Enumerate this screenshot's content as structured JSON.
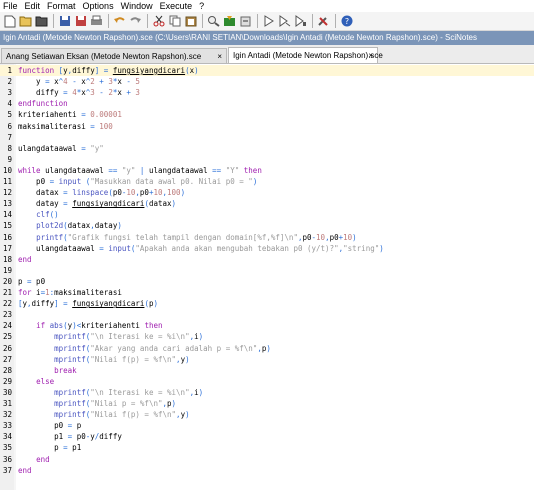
{
  "menubar": [
    "File",
    "Edit",
    "Format",
    "Options",
    "Window",
    "Execute",
    "?"
  ],
  "toolbar_icons": [
    "new-file-icon",
    "open-folder-icon",
    "open-file-icon",
    "sep",
    "save-icon",
    "save-as-icon",
    "print-icon",
    "sep",
    "undo-icon",
    "redo-icon",
    "sep",
    "cut-icon",
    "copy-icon",
    "paste-icon",
    "sep",
    "find-icon",
    "execute-file-icon",
    "load-into-scilab-icon",
    "sep",
    "execute-icon",
    "execute-until-cursor-icon",
    "execute-selection-icon",
    "sep",
    "tools-icon",
    "sep",
    "help-icon"
  ],
  "window_title": "Igin Antadi (Metode Newton Rapshon).sce (C:\\Users\\RANI SETIAN\\Downloads\\Igin Antadi (Metode Newton Rapshon).sce) - SciNotes",
  "tabs": [
    {
      "label": "Anang Setiawan Eksan (Metode Newton Rapshon).sce",
      "close": "×"
    },
    {
      "label": "Igin Antadi (Metode Newton Rapshon).sce",
      "close": "×"
    }
  ],
  "colors": {
    "keyword": "#a020b0",
    "function": "#4a55c0",
    "string": "#9a9a9a",
    "number": "#bc7a7a",
    "titlebar": "#7b95b8"
  },
  "code_lines": [
    {
      "n": "1",
      "t": "function [y,diffy] = fungsiyangdicari(x)"
    },
    {
      "n": "2",
      "t": "    y = x^4 - x^2 + 3*x - 5"
    },
    {
      "n": "3",
      "t": "    diffy = 4*x^3 - 2*x + 3"
    },
    {
      "n": "4",
      "t": "endfunction"
    },
    {
      "n": "5",
      "t": "kriteriahenti = 0.00001"
    },
    {
      "n": "6",
      "t": "maksimaliterasi = 100"
    },
    {
      "n": "7",
      "t": ""
    },
    {
      "n": "8",
      "t": "ulangdataawal = \"y\""
    },
    {
      "n": "9",
      "t": ""
    },
    {
      "n": "10",
      "t": "while ulangdataawal == \"y\" | ulangdataawal == \"Y\" then"
    },
    {
      "n": "11",
      "t": "    p0 = input (\"Masukkan data awal p0. Nilai p0 = \")"
    },
    {
      "n": "12",
      "t": "    datax = linspace(p0-10,p0+10,100)"
    },
    {
      "n": "13",
      "t": "    datay = fungsiyangdicari(datax)"
    },
    {
      "n": "14",
      "t": "    clf()"
    },
    {
      "n": "15",
      "t": "    plot2d(datax,datay)"
    },
    {
      "n": "16",
      "t": "    printf(\"Grafik fungsi telah tampil dengan domain[%f,%f]\\n\",p0-10,p0+10)"
    },
    {
      "n": "17",
      "t": "    ulangdataawal = input(\"Apakah anda akan mengubah tebakan p0 (y/t)?\",\"string\")"
    },
    {
      "n": "18",
      "t": "end"
    },
    {
      "n": "19",
      "t": ""
    },
    {
      "n": "20",
      "t": "p = p0"
    },
    {
      "n": "21",
      "t": "for i=1:maksimaliterasi"
    },
    {
      "n": "22",
      "t": "[y,diffy] = fungsiyangdicari(p)"
    },
    {
      "n": "23",
      "t": "    "
    },
    {
      "n": "24",
      "t": "    if abs(y)<kriteriahenti then"
    },
    {
      "n": "25",
      "t": "        mprintf(\"\\n Iterasi ke = %i\\n\",i)"
    },
    {
      "n": "26",
      "t": "        mprintf(\"Akar yang anda cari adalah p = %f\\n\",p)"
    },
    {
      "n": "27",
      "t": "        mprintf(\"Nilai f(p) = %f\\n\",y)"
    },
    {
      "n": "28",
      "t": "        break"
    },
    {
      "n": "29",
      "t": "    else"
    },
    {
      "n": "30",
      "t": "        mprintf(\"\\n Iterasi ke = %i\\n\",i)"
    },
    {
      "n": "31",
      "t": "        mprintf(\"Nilai p = %f\\n\",p)"
    },
    {
      "n": "32",
      "t": "        mprintf(\"Nilai f(p) = %f\\n\",y)"
    },
    {
      "n": "33",
      "t": "        p0 = p"
    },
    {
      "n": "34",
      "t": "        p1 = p0-y/diffy"
    },
    {
      "n": "35",
      "t": "        p = p1"
    },
    {
      "n": "36",
      "t": "    end"
    },
    {
      "n": "37",
      "t": "end"
    }
  ]
}
